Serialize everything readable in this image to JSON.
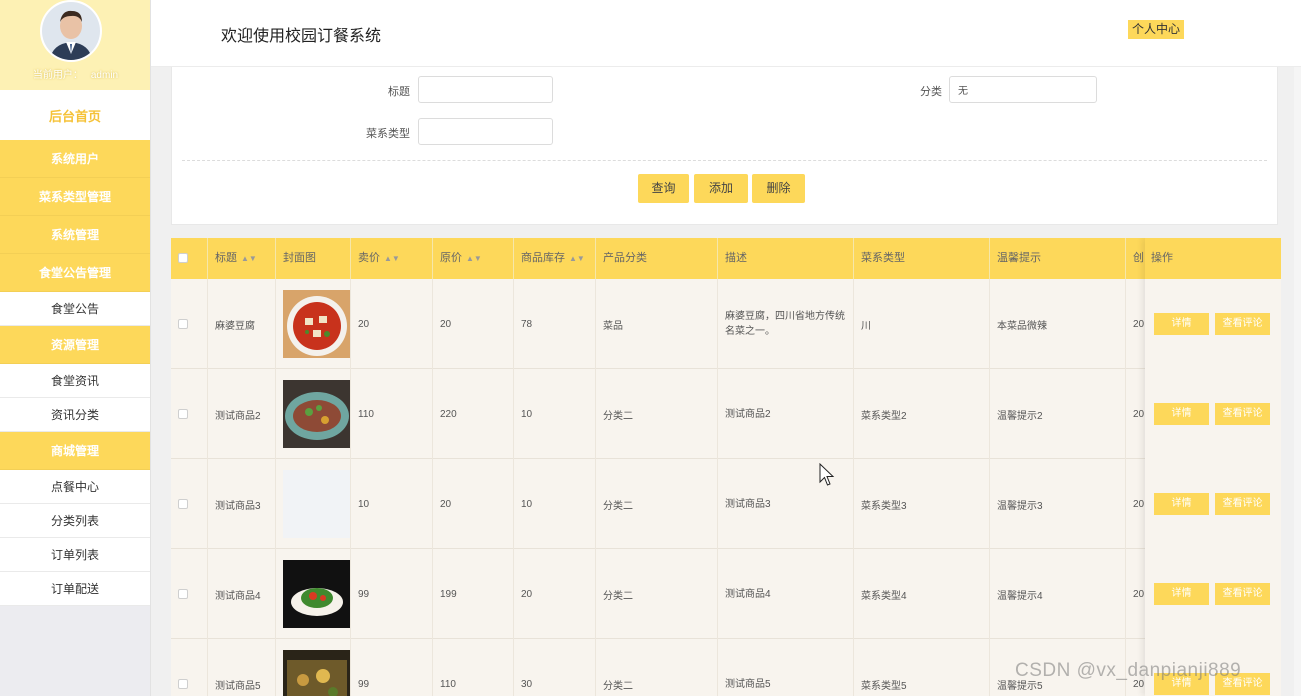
{
  "sidebar": {
    "user_label": "当前用户：",
    "username": "admin",
    "home": "后台首页",
    "sections": [
      {
        "title": "系统用户",
        "items": []
      },
      {
        "title": "菜系类型管理",
        "items": []
      },
      {
        "title": "系统管理",
        "items": []
      },
      {
        "title": "食堂公告管理",
        "items": [
          "食堂公告"
        ]
      },
      {
        "title": "资源管理",
        "items": [
          "食堂资讯",
          "资讯分类"
        ]
      },
      {
        "title": "商城管理",
        "items": [
          "点餐中心",
          "分类列表",
          "订单列表",
          "订单配送"
        ]
      }
    ]
  },
  "header": {
    "title": "欢迎使用校园订餐系统",
    "personal_center": "个人中心"
  },
  "search": {
    "title_label": "标题",
    "title_value": "",
    "category_label": "分类",
    "category_value": "无",
    "cuisine_label": "菜系类型",
    "cuisine_value": "",
    "query_btn": "查询",
    "add_btn": "添加",
    "delete_btn": "删除"
  },
  "table": {
    "columns": [
      "标题",
      "封面图",
      "卖价",
      "原价",
      "商品库存",
      "产品分类",
      "描述",
      "菜系类型",
      "温馨提示",
      "创"
    ],
    "actions_header": "操作",
    "detail_btn": "详情",
    "review_btn": "查看评论",
    "rows": [
      {
        "title": "麻婆豆腐",
        "sell": "20",
        "orig": "20",
        "stock": "78",
        "category": "菜品",
        "desc": "麻婆豆腐，四川省地方传统名菜之一。",
        "cuisine": "川",
        "tip": "本菜品微辣",
        "created": "20"
      },
      {
        "title": "测试商品2",
        "sell": "110",
        "orig": "220",
        "stock": "10",
        "category": "分类二",
        "desc": "测试商品2",
        "cuisine": "菜系类型2",
        "tip": "温馨提示2",
        "created": "20"
      },
      {
        "title": "测试商品3",
        "sell": "10",
        "orig": "20",
        "stock": "10",
        "category": "分类二",
        "desc": "测试商品3",
        "cuisine": "菜系类型3",
        "tip": "温馨提示3",
        "created": "20"
      },
      {
        "title": "测试商品4",
        "sell": "99",
        "orig": "199",
        "stock": "20",
        "category": "分类二",
        "desc": "测试商品4",
        "cuisine": "菜系类型4",
        "tip": "温馨提示4",
        "created": "20"
      },
      {
        "title": "测试商品5",
        "sell": "99",
        "orig": "110",
        "stock": "30",
        "category": "分类二",
        "desc": "测试商品5",
        "cuisine": "菜系类型5",
        "tip": "温馨提示5",
        "created": "20"
      }
    ]
  },
  "watermark": "CSDN @vx_danpianji889",
  "colors": {
    "accent": "#fdd85a",
    "sidebar_top": "#fdf1b4",
    "row_bg": "#f8f4ee"
  }
}
